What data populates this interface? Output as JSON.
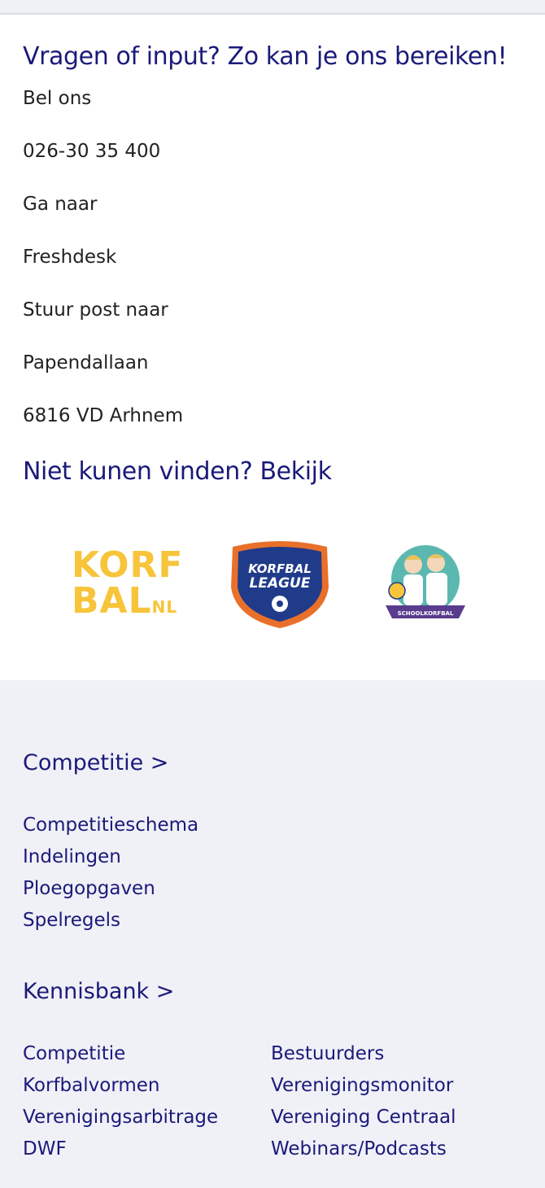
{
  "contact": {
    "heading": "Vragen of input? Zo kan je ons bereiken!",
    "lines": [
      "Bel ons",
      "026-30 35 400",
      "Ga naar",
      "Freshdesk",
      "Stuur post naar",
      "Papendallaan",
      "6816 VD Arhnem"
    ],
    "subheading": "Niet kunen vinden? Bekijk"
  },
  "logos": {
    "korfbal_line1": "KORF",
    "korfbal_line2": "BAL",
    "korfbal_suffix": "NL",
    "league_line1": "KORFBAL",
    "league_line2": "LEAGUE",
    "school": "SCHOOLKORFBAL"
  },
  "footer": {
    "competitie_title": "Competitie >",
    "competitie_links": [
      "Competitieschema",
      "Indelingen",
      "Ploegopgaven",
      "Spelregels"
    ],
    "kennisbank_title": "Kennisbank >",
    "kennisbank_left": [
      "Competitie",
      "Korfbalvormen",
      "Verenigingsarbitrage",
      "DWF"
    ],
    "kennisbank_right": [
      "Bestuurders",
      "Verenigingsmonitor",
      "Vereniging Centraal",
      "Webinars/Podcasts"
    ]
  },
  "colors": {
    "primary": "#1a1a7a",
    "logo_yellow": "#f7c43a",
    "league_orange": "#e8702a",
    "league_navy": "#1f3b8a",
    "background": "#f0f0f7"
  }
}
